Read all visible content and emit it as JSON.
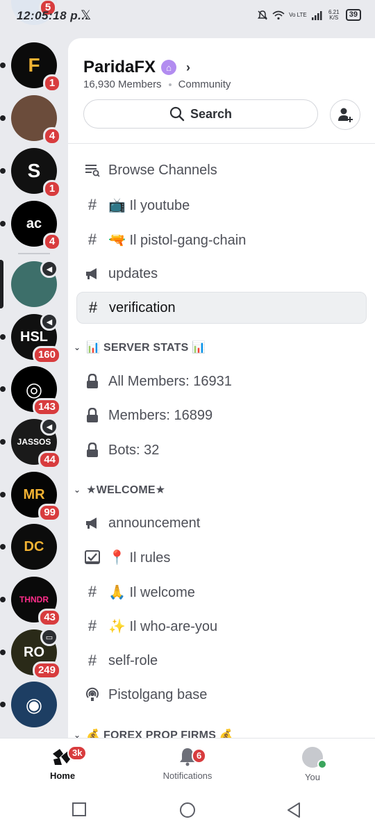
{
  "status_bar": {
    "time": "12:05:18 p...",
    "network": "Vo LTE",
    "speed": "6.21 K/S",
    "battery": "39"
  },
  "rail": {
    "servers": [
      {
        "name": "server-fx",
        "badge": "1",
        "bg": "#0b0b0b",
        "glyph": "F"
      },
      {
        "name": "server-person",
        "badge": "4",
        "bg": "#6b4c3b",
        "glyph": ""
      },
      {
        "name": "server-circle-logo",
        "badge": "1",
        "bg": "#111111",
        "glyph": "S"
      },
      {
        "name": "server-ac",
        "badge": "4",
        "bg": "#000000",
        "glyph": "ac"
      },
      {
        "name": "server-scene",
        "badge": "",
        "bg": "#3d6f6a",
        "glyph": ""
      },
      {
        "name": "server-hsl",
        "badge": "160",
        "bg": "#101010",
        "glyph": "HSL"
      },
      {
        "name": "server-swoosh",
        "badge": "143",
        "bg": "#000000",
        "glyph": "◎"
      },
      {
        "name": "server-jassos",
        "badge": "44",
        "bg": "#1a1a1a",
        "glyph": "JASSOS"
      },
      {
        "name": "server-mr",
        "badge": "99",
        "bg": "#050505",
        "glyph": "MR"
      },
      {
        "name": "server-dc",
        "badge": "",
        "bg": "#0c0c0c",
        "glyph": "DC"
      },
      {
        "name": "server-thndr",
        "badge": "43",
        "bg": "#0a0a0a",
        "glyph": "THNDR"
      },
      {
        "name": "server-ro",
        "badge": "249",
        "bg": "#2a2a18",
        "glyph": "RO"
      },
      {
        "name": "server-ring",
        "badge": "",
        "bg": "#1d3e63",
        "glyph": "◉"
      }
    ],
    "top_badge": "5"
  },
  "server": {
    "name": "ParidaFX",
    "members": "16,930 Members",
    "type": "Community",
    "search_label": "Search"
  },
  "channels": {
    "browse": "Browse Channels",
    "youtube": "📺 Il youtube",
    "pistol": "🔫 Il pistol-gang-chain",
    "updates": "updates",
    "verification": "verification",
    "cat_stats": "📊 SERVER STATS 📊",
    "all_members": "All Members: 16931",
    "members": "Members: 16899",
    "bots": "Bots: 32",
    "cat_welcome": "★WELCOME★",
    "announcement": "announcement",
    "rules": "📍 Il rules",
    "welcome": "🙏 Il welcome",
    "who": "✨ Il who-are-you",
    "self_role": "self-role",
    "pistolgang_base": "Pistolgang base",
    "cat_forex": "💰 FOREX PROP FIRMS 💰"
  },
  "bottom_nav": {
    "home": "Home",
    "home_badge": "3k",
    "notifications": "Notifications",
    "notif_badge": "6",
    "you": "You"
  },
  "colors": {
    "badge": "#d83c3e",
    "online": "#3ba55d",
    "nitro": "#b28cf0"
  }
}
